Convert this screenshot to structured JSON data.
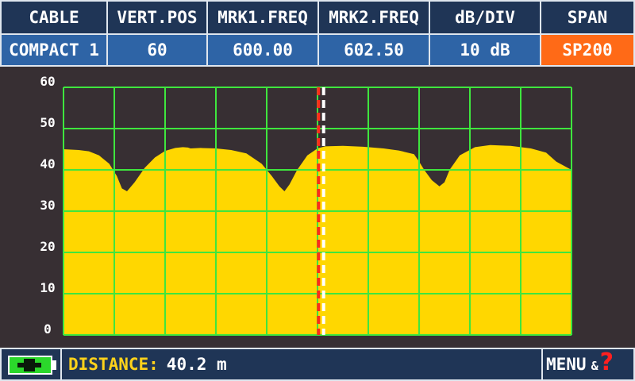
{
  "header": {
    "columns": [
      {
        "label": "CABLE",
        "value": "COMPACT 1"
      },
      {
        "label": "VERT.POS",
        "value": "60"
      },
      {
        "label": "MRK1.FREQ",
        "value": "600.00"
      },
      {
        "label": "MRK2.FREQ",
        "value": "602.50"
      },
      {
        "label": "dB/DIV",
        "value": "10 dB"
      },
      {
        "label": "SPAN",
        "value": "SP200"
      }
    ],
    "span_color": "#ff6a17"
  },
  "chart_data": {
    "type": "area",
    "y_ticks": [
      "60",
      "50",
      "40",
      "30",
      "20",
      "10",
      "0"
    ],
    "ylim": [
      0,
      60
    ],
    "xlim": [
      0,
      100
    ],
    "grid": true,
    "x_divisions": 10,
    "y_divisions": 6,
    "fill_color": "#ffd700",
    "grid_color": "#3ee63e",
    "x": [
      0,
      3,
      5,
      7,
      9,
      10.5,
      11.5,
      12.5,
      14,
      16,
      18,
      20,
      22,
      23.5,
      24.5,
      25,
      27,
      30,
      33,
      36,
      39,
      41,
      42.5,
      43.5,
      44.5,
      46,
      48,
      50,
      51.5,
      55,
      59,
      63,
      66,
      69,
      70,
      71,
      72.5,
      74,
      75,
      76,
      78,
      81,
      84,
      88,
      92,
      95,
      97,
      100
    ],
    "values": [
      45.0,
      44.8,
      44.5,
      43.5,
      41.5,
      38.5,
      35.5,
      34.8,
      37.0,
      40.5,
      43.0,
      44.6,
      45.3,
      45.5,
      45.4,
      45.2,
      45.3,
      45.2,
      44.8,
      44.0,
      41.5,
      38.5,
      36.0,
      34.8,
      36.5,
      40.0,
      43.5,
      45.2,
      45.7,
      45.8,
      45.6,
      45.2,
      44.7,
      43.8,
      42.0,
      40.0,
      37.5,
      36.0,
      37.0,
      40.0,
      43.5,
      45.5,
      46.0,
      45.8,
      45.2,
      44.2,
      42.0,
      40.0
    ],
    "markers": [
      {
        "name": "MRK1",
        "x": 50.2,
        "color": "#ff2a1a"
      },
      {
        "name": "MRK2",
        "x": 51.2,
        "color": "#ffffff"
      }
    ]
  },
  "footer": {
    "distance_label": "DISTANCE:",
    "distance_value": "40.2 m",
    "menu_label": "MENU",
    "menu_amp": "&",
    "menu_help": "?"
  }
}
